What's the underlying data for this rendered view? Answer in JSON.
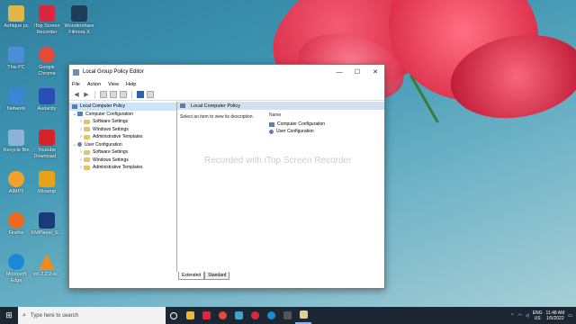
{
  "desktop": {
    "icons": [
      {
        "label": "Ashique pc",
        "color": "#e0b84a"
      },
      {
        "label": "iTop Screen Recorder",
        "color": "#d9283c"
      },
      {
        "label": "Wondershare Filmora X",
        "color": "#1e3c5a"
      },
      {
        "label": "This PC",
        "color": "#4a8fd6"
      },
      {
        "label": "Google Chrome",
        "color": "#e24a3a"
      },
      {
        "label": "Network",
        "color": "#3b86d4"
      },
      {
        "label": "Audacity",
        "color": "#2c4db7"
      },
      {
        "label": "Recycle Bin",
        "color": "#8db3d8"
      },
      {
        "label": "Youtube Download...",
        "color": "#d4242a"
      },
      {
        "label": "AIMP3",
        "color": "#f0a22a"
      },
      {
        "label": "Winamp",
        "color": "#e8a21a"
      },
      {
        "label": "Firefox",
        "color": "#e86a1a"
      },
      {
        "label": "KMPlayer_E...",
        "color": "#1a3a7a"
      },
      {
        "label": "Microsoft Edge",
        "color": "#1a8ad6"
      },
      {
        "label": "vlc-2.2.2-w...",
        "color": "#f08a1a"
      }
    ]
  },
  "window": {
    "title": "Local Group Policy Editor",
    "controls": {
      "minimize": "—",
      "maximize": "☐",
      "close": "✕"
    },
    "menu": [
      "File",
      "Action",
      "View",
      "Help"
    ],
    "tree": {
      "root": "Local Computer Policy",
      "computer_config": "Computer Configuration",
      "computer_children": [
        "Software Settings",
        "Windows Settings",
        "Administrative Templates"
      ],
      "user_config": "User Configuration",
      "user_children": [
        "Software Settings",
        "Windows Settings",
        "Administrative Templates"
      ]
    },
    "right_pane": {
      "header": "Local Computer Policy",
      "description": "Select an item to view its description.",
      "column_name": "Name",
      "items": [
        "Computer Configuration",
        "User Configuration"
      ]
    },
    "tabs": [
      "Extended",
      "Standard"
    ]
  },
  "watermark": "Recorded with iTop Screen Recorder",
  "taskbar": {
    "search_placeholder": "Type here to search",
    "icons": [
      {
        "name": "task-view-icon",
        "color": "#ffffff"
      },
      {
        "name": "file-explorer-icon",
        "color": "#e8b93a"
      },
      {
        "name": "itop-recorder-icon",
        "color": "#d9283c"
      },
      {
        "name": "chrome-icon",
        "color": "#e24a3a"
      },
      {
        "name": "filmora-icon",
        "color": "#3fa2c9"
      },
      {
        "name": "recorder-icon",
        "color": "#d9283c"
      },
      {
        "name": "edge-icon",
        "color": "#1a8ad6"
      },
      {
        "name": "store-icon",
        "color": "#555555"
      },
      {
        "name": "gpedit-icon",
        "color": "#e0d090"
      }
    ],
    "language": "ENG",
    "region": "US",
    "time": "11:48 AM",
    "date": "1/5/2022"
  }
}
